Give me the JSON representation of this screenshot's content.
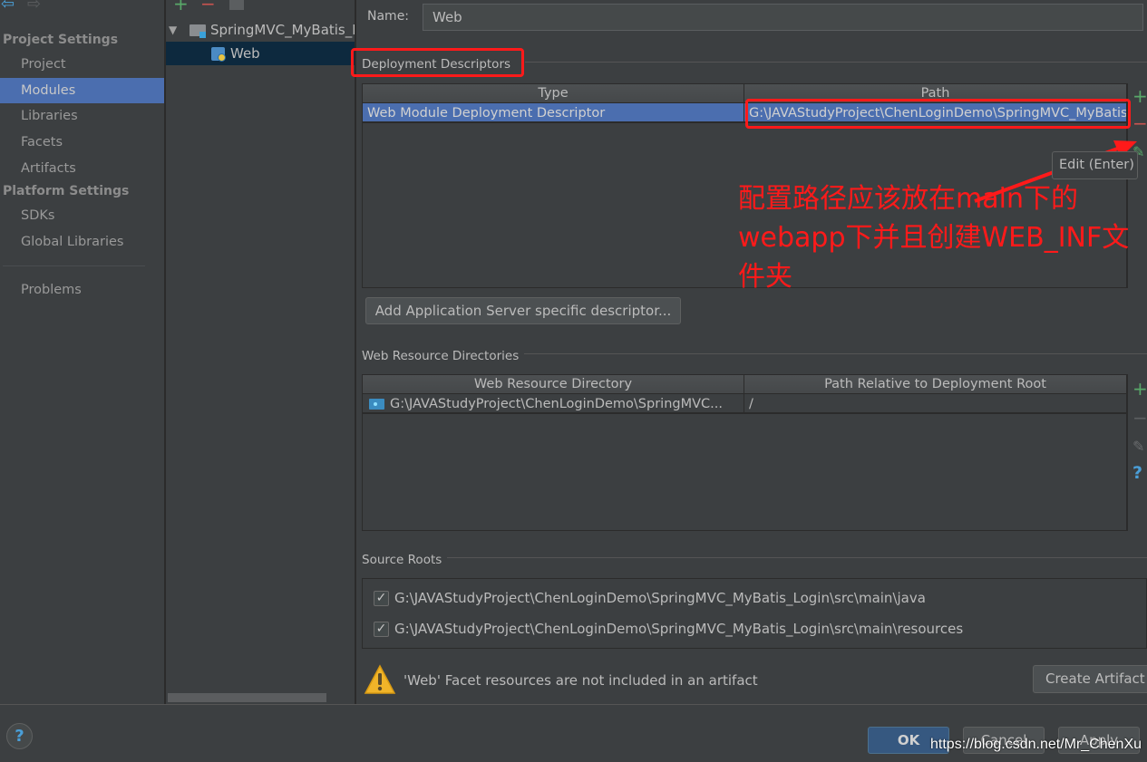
{
  "nav": {
    "back_icon": "arrow-left-icon",
    "forward_icon": "arrow-right-icon",
    "project_settings_header": "Project Settings",
    "platform_settings_header": "Platform Settings",
    "items": [
      {
        "label": "Project",
        "selected": false
      },
      {
        "label": "Modules",
        "selected": true
      },
      {
        "label": "Libraries",
        "selected": false
      },
      {
        "label": "Facets",
        "selected": false
      },
      {
        "label": "Artifacts",
        "selected": false
      },
      {
        "label": "SDKs",
        "selected": false
      },
      {
        "label": "Global Libraries",
        "selected": false
      },
      {
        "label": "Problems",
        "selected": false
      }
    ]
  },
  "tree": {
    "toolbar": {
      "add": "+",
      "remove": "−",
      "copy_icon": "copy-icon"
    },
    "module": {
      "label": "SpringMVC_MyBatis_Login",
      "expanded": true
    },
    "facet": {
      "label": "Web",
      "selected": true
    }
  },
  "main": {
    "name_label": "Name:",
    "name_value": "Web",
    "deployment_descriptors": {
      "title": "Deployment Descriptors",
      "columns": [
        "Type",
        "Path"
      ],
      "rows": [
        {
          "type": "Web Module Deployment Descriptor",
          "path": "G:\\JAVAStudyProject\\ChenLoginDemo\\SpringMVC_MyBatis_Login\\web\\WEB-INF\\web.xml"
        }
      ],
      "add_server_descriptor_button": "Add Application Server specific descriptor..."
    },
    "web_resource_directories": {
      "title": "Web Resource Directories",
      "columns": [
        "Web Resource Directory",
        "Path Relative to Deployment Root"
      ],
      "rows": [
        {
          "directory": "G:\\JAVAStudyProject\\ChenLoginDemo\\SpringMVC...",
          "relative_path": "/"
        }
      ]
    },
    "source_roots": {
      "title": "Source Roots",
      "items": [
        {
          "path": "G:\\JAVAStudyProject\\ChenLoginDemo\\SpringMVC_MyBatis_Login\\src\\main\\java",
          "checked": true
        },
        {
          "path": "G:\\JAVAStudyProject\\ChenLoginDemo\\SpringMVC_MyBatis_Login\\src\\main\\resources",
          "checked": true
        }
      ]
    },
    "warning": {
      "text": "'Web' Facet resources are not included in an artifact",
      "button": "Create Artifact"
    },
    "tooltip": "Edit (Enter)"
  },
  "annotation": {
    "text": "配置路径应该放在main下的webapp下并且创建WEB_INF文件夹",
    "color": "#ff1a1a"
  },
  "footer": {
    "help": "?",
    "ok": "OK",
    "cancel": "Cancel",
    "apply": "Apply",
    "watermark": "https://blog.csdn.net/Mr_ChenXu"
  },
  "colors": {
    "background": "#3c3f41",
    "selection": "#4b6eaf",
    "tree_selection": "#0d293e",
    "add_green": "#59a869",
    "remove_red": "#c75450",
    "ok_blue": "#365880"
  }
}
